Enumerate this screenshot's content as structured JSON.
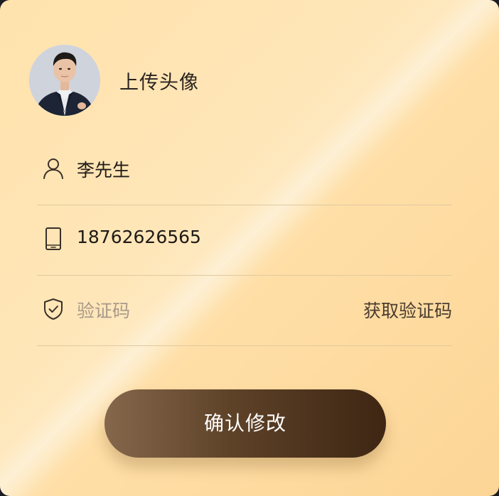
{
  "avatar": {
    "title": "上传头像"
  },
  "form": {
    "name_value": "李先生",
    "phone_value": "18762626565",
    "code_placeholder": "验证码",
    "get_code_label": "获取验证码"
  },
  "submit": {
    "label": "确认修改"
  },
  "icons": {
    "name": "user-icon",
    "phone": "phone-icon",
    "code": "shield-check-icon"
  },
  "colors": {
    "card_light": "#ffe6b8",
    "card_dark": "#fcd596",
    "button_start": "#85674c",
    "button_end": "#3e2613"
  }
}
